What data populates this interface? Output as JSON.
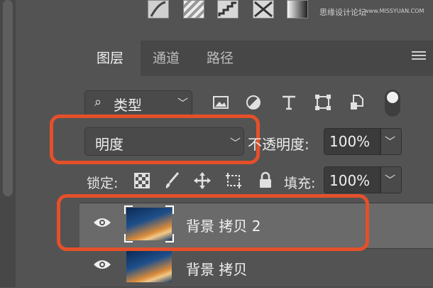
{
  "watermark": {
    "text": "思缘设计论坛",
    "url": "www.MISSYUAN.COM"
  },
  "tabs": [
    {
      "label": "图层",
      "active": true
    },
    {
      "label": "通道",
      "active": false
    },
    {
      "label": "路径",
      "active": false
    }
  ],
  "filter": {
    "kind_label": "类型"
  },
  "blend": {
    "mode": "明度"
  },
  "opacity": {
    "label": "不透明度:",
    "value": "100%"
  },
  "lock": {
    "label": "锁定:"
  },
  "fill": {
    "label": "填充:",
    "value": "100%"
  },
  "layers": [
    {
      "name": "背景 拷贝 2",
      "selected": true
    },
    {
      "name": "背景 拷贝",
      "selected": false
    }
  ],
  "colors": {
    "highlight": "#e4502a",
    "panel": "#535353",
    "selected_row": "#6a6a6a"
  }
}
